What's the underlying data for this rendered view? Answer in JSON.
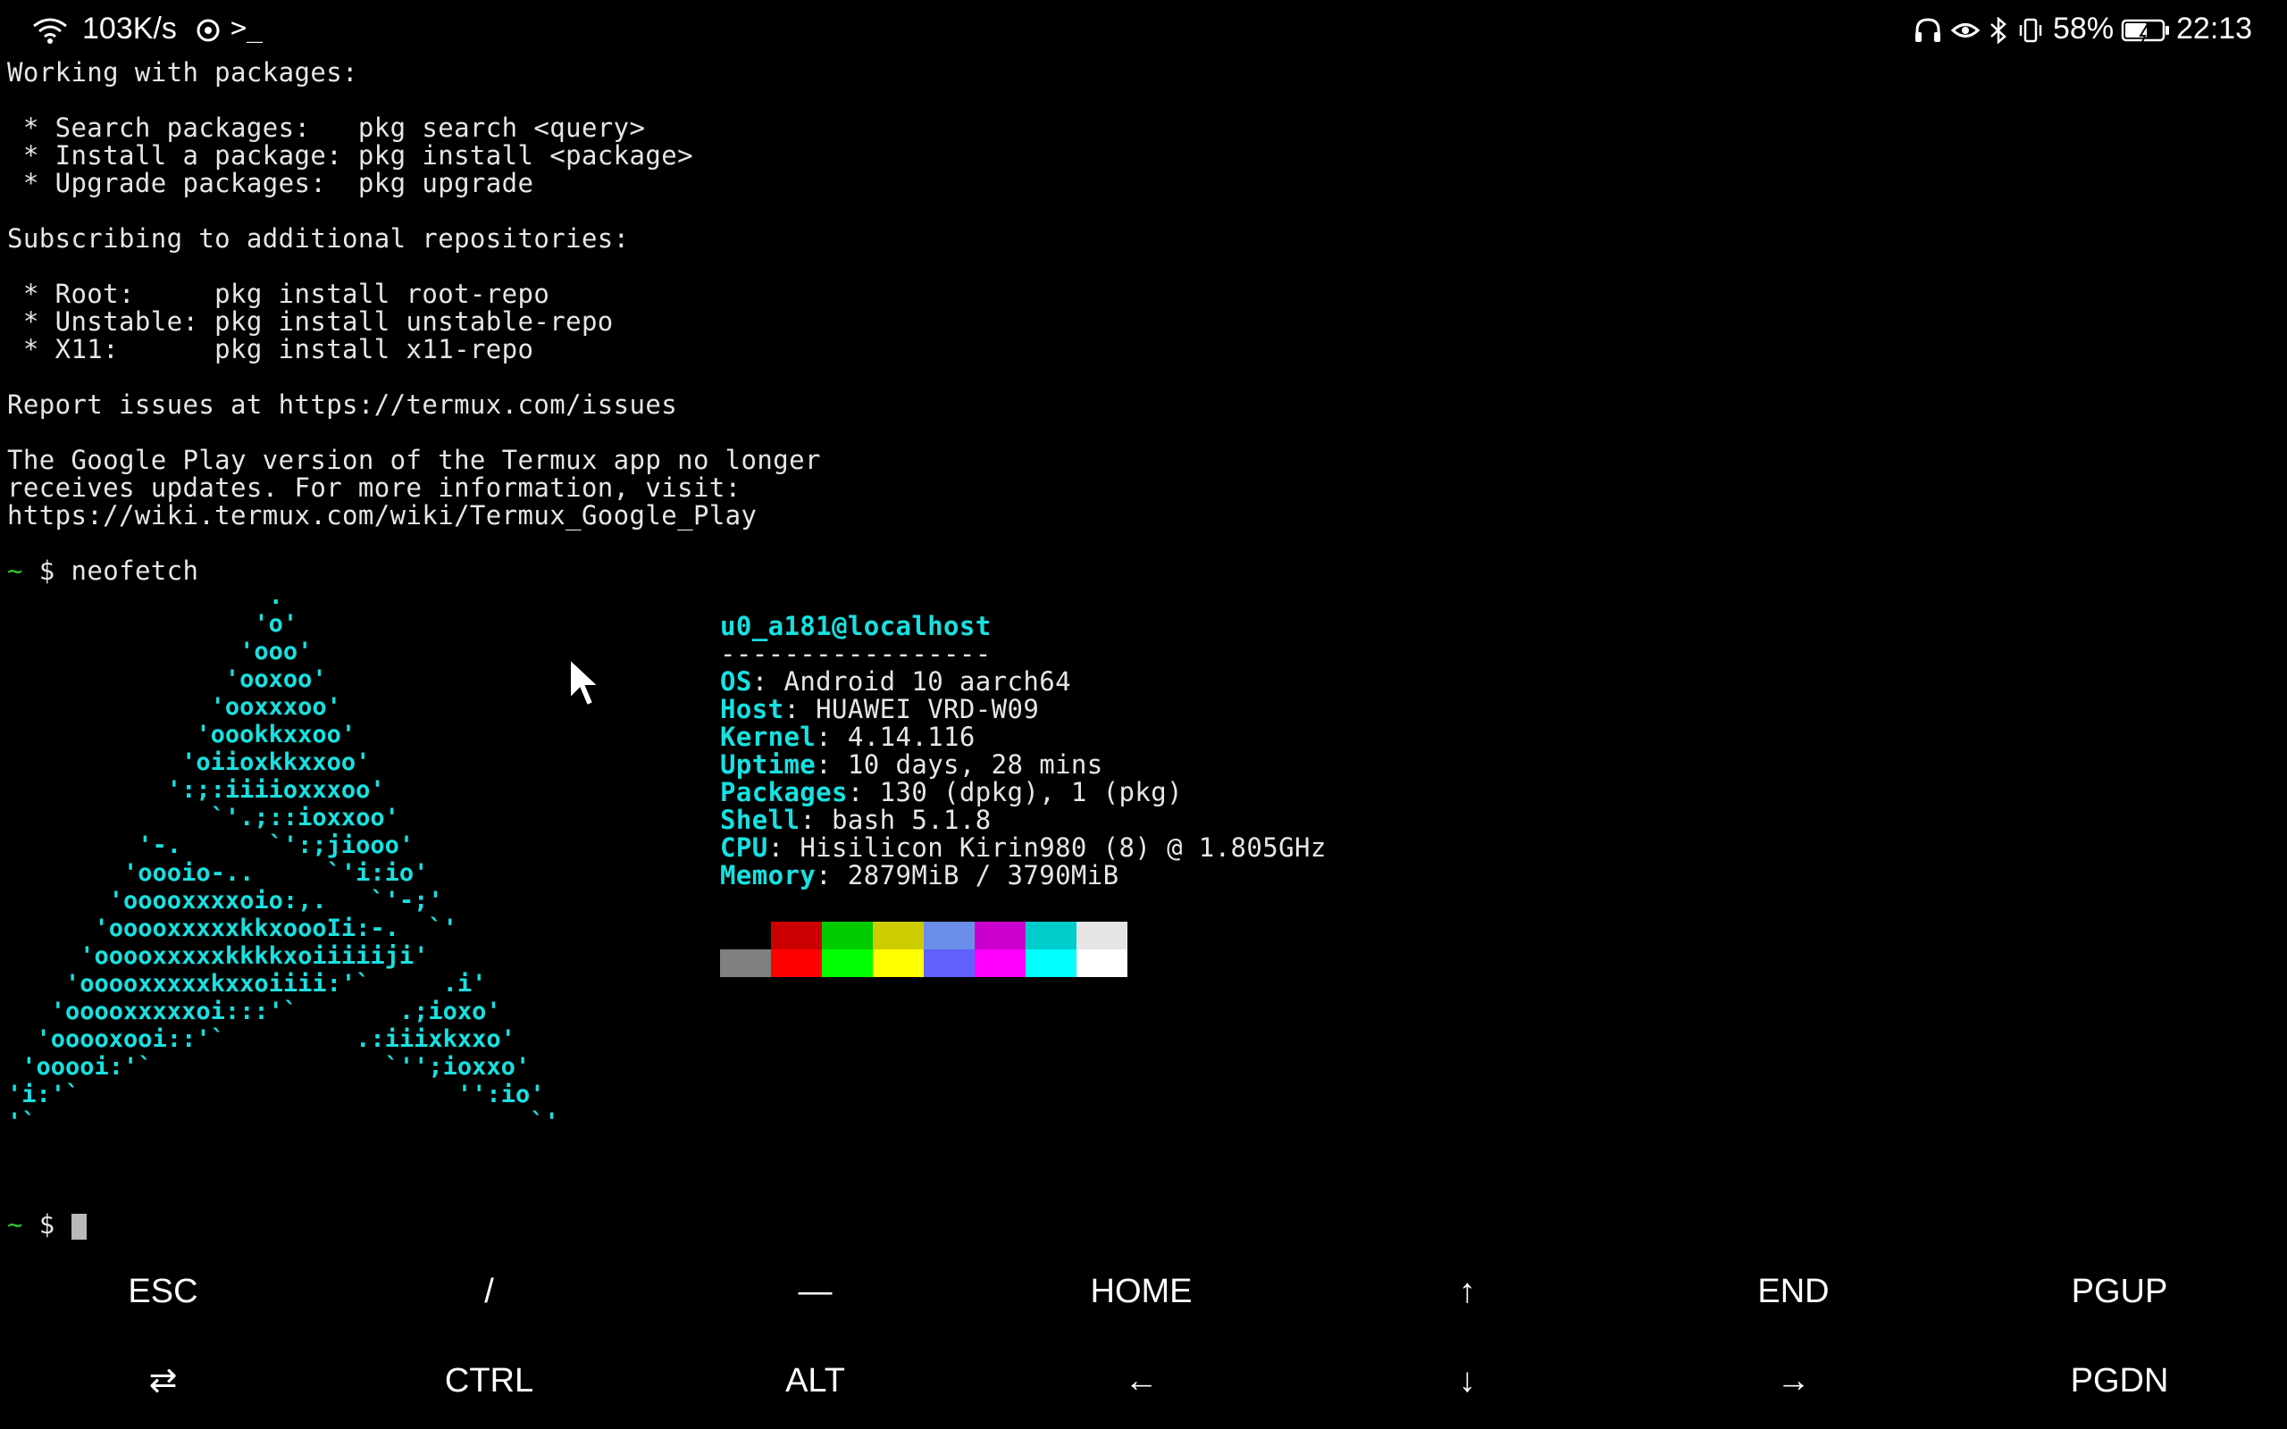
{
  "status_bar": {
    "net_speed": "103K/s",
    "shell_icon": ">_",
    "battery_percent": "58%",
    "time": "22:13",
    "icons": [
      "wifi-icon",
      "sync-icon",
      "terminal-icon",
      "headphones-icon",
      "eye-icon",
      "bluetooth-icon",
      "vibrate-icon",
      "battery-icon"
    ]
  },
  "terminal": {
    "lines": [
      "Working with packages:",
      "",
      " * Search packages:   pkg search <query>",
      " * Install a package: pkg install <package>",
      " * Upgrade packages:  pkg upgrade",
      "",
      "Subscribing to additional repositories:",
      "",
      " * Root:     pkg install root-repo",
      " * Unstable: pkg install unstable-repo",
      " * X11:      pkg install x11-repo",
      "",
      "Report issues at https://termux.com/issues",
      "",
      "The Google Play version of the Termux app no longer",
      "receives updates. For more information, visit:",
      "https://wiki.termux.com/wiki/Termux_Google_Play"
    ],
    "prompt_symbol": "~",
    "prompt_dollar": "$",
    "command": "neofetch",
    "ascii_art": "                  .\n                 'o'\n                'ooo'\n               'ooxoo'\n              'ooxxxoo'\n             'oookkxxoo'\n            'oiioxkkxxoo'\n           ':;:iiiioxxxoo'\n              `'.;::ioxxoo'\n         '-.      `':;jiooo'\n        'oooio-..     `'i:io'\n       'ooooxxxxoio:,.   `'-;'\n      'ooooxxxxxkkxoooIi:-.  `'\n     'ooooxxxxxkkkkxoiiiiiji'\n    'ooooxxxxxkxxoiiii:'`     .i'\n   'ooooxxxxxoi:::'`       .;ioxo'\n  'ooooxooi::'`         .:iiixkxxo'\n 'ooooi:'`                `'';ioxxo'\n'i:'`                          '':io'\n'`                                  `'",
    "info": {
      "user_host": "u0_a181@localhost",
      "separator": "-----------------",
      "fields": [
        {
          "label": "OS",
          "value": ": Android 10 aarch64"
        },
        {
          "label": "Host",
          "value": ": HUAWEI VRD-W09"
        },
        {
          "label": "Kernel",
          "value": ": 4.14.116"
        },
        {
          "label": "Uptime",
          "value": ": 10 days, 28 mins"
        },
        {
          "label": "Packages",
          "value": ": 130 (dpkg), 1 (pkg)"
        },
        {
          "label": "Shell",
          "value": ": bash 5.1.8"
        },
        {
          "label": "CPU",
          "value": ": Hisilicon Kirin980 (8) @ 1.805GHz"
        },
        {
          "label": "Memory",
          "value": ": 2879MiB / 3790MiB"
        }
      ],
      "palette_top": [
        "#000000",
        "#cc0000",
        "#00cc00",
        "#cccc00",
        "#6b8fe8",
        "#cc00cc",
        "#00cccc",
        "#e5e5e5"
      ],
      "palette_bottom": [
        "#808080",
        "#ff0000",
        "#00ff00",
        "#ffff00",
        "#6060ff",
        "#ff00ff",
        "#00ffff",
        "#ffffff"
      ]
    }
  },
  "extra_keys": {
    "row1": [
      "ESC",
      "/",
      "—",
      "HOME",
      "↑",
      "END",
      "PGUP"
    ],
    "row2": [
      "⇄",
      "CTRL",
      "ALT",
      "←",
      "↓",
      "→",
      "PGDN"
    ]
  }
}
